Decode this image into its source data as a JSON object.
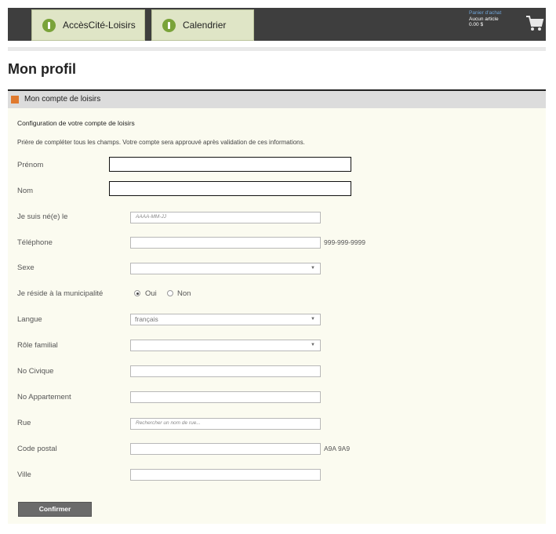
{
  "nav": {
    "tab1_label": "AccèsCité-Loisirs",
    "tab2_label": "Calendrier"
  },
  "cart": {
    "title": "Panier d'achat",
    "items": "Aucun article",
    "total": "0.00 $"
  },
  "page": {
    "title": "Mon profil"
  },
  "panel": {
    "title": "Mon compte de loisirs",
    "section_title": "Configuration de votre compte de loisirs",
    "description": "Prière de compléter tous les champs. Votre compte sera approuvé après validation de ces informations."
  },
  "form": {
    "prenom_label": "Prénom",
    "nom_label": "Nom",
    "naissance_label": "Je suis né(e) le",
    "naissance_placeholder": "AAAA-MM-JJ",
    "telephone_label": "Téléphone",
    "telephone_hint": "999-999-9999",
    "sexe_label": "Sexe",
    "reside_label": "Je réside à la municipalité",
    "reside_oui": "Oui",
    "reside_non": "Non",
    "reside_selected": "Oui",
    "langue_label": "Langue",
    "langue_value": "français",
    "role_label": "Rôle familial",
    "civique_label": "No Civique",
    "appartement_label": "No Appartement",
    "rue_label": "Rue",
    "rue_placeholder": "Rechercher un nom de rue...",
    "postal_label": "Code postal",
    "postal_hint": "A9A 9A9",
    "ville_label": "Ville",
    "confirm_label": "Confirmer"
  },
  "colors": {
    "topbar": "#3e3e3e",
    "tab_bg": "#dfe5c6",
    "tab_icon": "#7aa33a",
    "panel_icon": "#e07a2e",
    "button": "#6b6b6b"
  },
  "icons": {
    "tab_icon": "leaf-circle-icon",
    "cart_icon": "shopping-cart-icon",
    "panel_icon": "section-square-icon",
    "select_arrow": "chevron-down-icon"
  }
}
